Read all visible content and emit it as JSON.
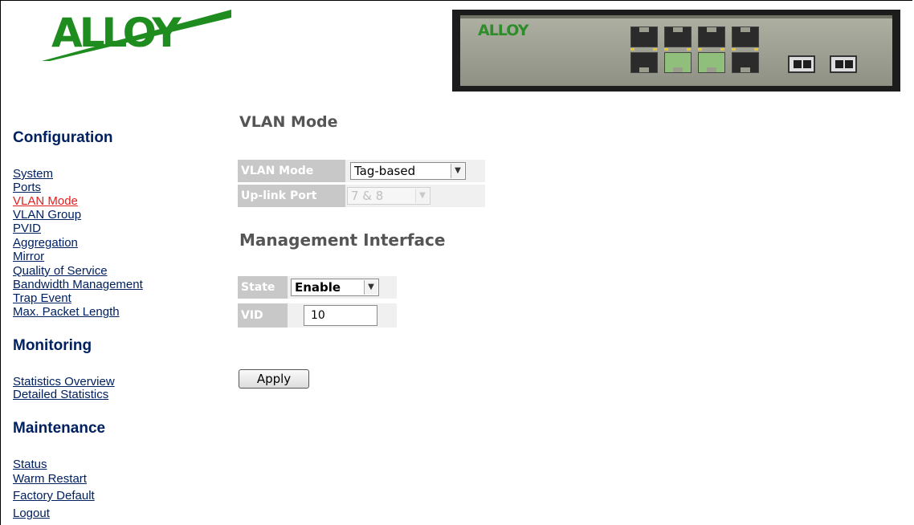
{
  "header": {
    "logo_text": "ALLOY",
    "switch_logo_text": "ALLOY"
  },
  "sidebar": {
    "configuration": {
      "title": "Configuration",
      "items": [
        {
          "label": "System",
          "active": false
        },
        {
          "label": "Ports",
          "active": false
        },
        {
          "label": "VLAN Mode",
          "active": true
        },
        {
          "label": "VLAN Group",
          "active": false
        },
        {
          "label": "PVID",
          "active": false
        },
        {
          "label": "Aggregation",
          "active": false
        },
        {
          "label": "Mirror",
          "active": false
        },
        {
          "label": "Quality of Service",
          "active": false
        },
        {
          "label": "Bandwidth Management",
          "active": false
        },
        {
          "label": "Trap Event",
          "active": false
        },
        {
          "label": "Max. Packet Length",
          "active": false
        }
      ]
    },
    "monitoring": {
      "title": "Monitoring",
      "items": [
        {
          "label": "Statistics Overview"
        },
        {
          "label": "Detailed Statistics"
        }
      ]
    },
    "maintenance": {
      "title": "Maintenance",
      "items": [
        {
          "label": "Status"
        },
        {
          "label": "Warm Restart"
        },
        {
          "label": "Factory Default"
        },
        {
          "label": "Logout"
        }
      ]
    }
  },
  "main": {
    "vlan_mode": {
      "heading": "VLAN Mode",
      "mode_label": "VLAN Mode",
      "mode_value": "Tag-based",
      "uplink_label": "Up-link Port",
      "uplink_value": "7 & 8"
    },
    "management": {
      "heading": "Management Interface",
      "state_label": "State",
      "state_value": "Enable",
      "vid_label": "VID",
      "vid_value": "10"
    },
    "apply_label": "Apply"
  },
  "colors": {
    "nav_link": "#002060",
    "nav_active": "#e02020",
    "logo_green": "#1e8c1e",
    "table_label_bg": "#c8c8c8"
  }
}
